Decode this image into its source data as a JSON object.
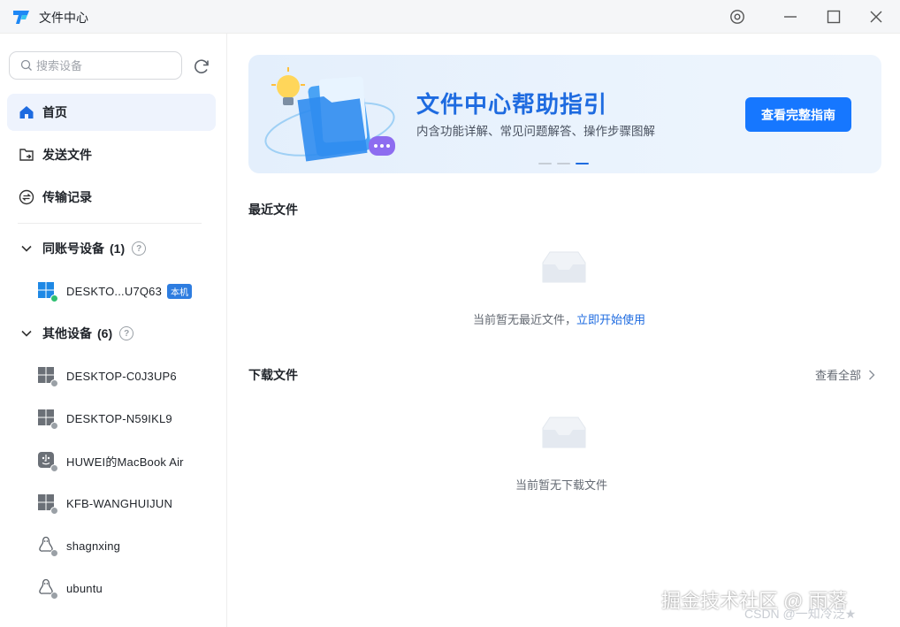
{
  "window": {
    "title": "文件中心",
    "buttons": [
      "settings-icon",
      "minimize-icon",
      "maximize-icon",
      "close-icon"
    ]
  },
  "sidebar": {
    "search_placeholder": "搜索设备",
    "nav": [
      {
        "label": "首页",
        "icon": "home-icon",
        "active": true
      },
      {
        "label": "发送文件",
        "icon": "send-file-icon",
        "active": false
      },
      {
        "label": "传输记录",
        "icon": "transfer-record-icon",
        "active": false
      }
    ],
    "groups": [
      {
        "label": "同账号设备",
        "count": "(1)",
        "expanded": true,
        "devices": [
          {
            "name": "DESKTO...U7Q63",
            "icon": "windows-icon",
            "badge": "本机",
            "online": true
          }
        ]
      },
      {
        "label": "其他设备",
        "count": "(6)",
        "expanded": true,
        "devices": [
          {
            "name": "DESKTOP-C0J3UP6",
            "icon": "windows-icon",
            "online": false
          },
          {
            "name": "DESKTOP-N59IKL9",
            "icon": "windows-icon",
            "online": false
          },
          {
            "name": "HUWEI的MacBook Air",
            "icon": "mac-icon",
            "online": false
          },
          {
            "name": "KFB-WANGHUIJUN",
            "icon": "windows-icon",
            "online": false
          },
          {
            "name": "shagnxing",
            "icon": "linux-icon",
            "online": false
          },
          {
            "name": "ubuntu",
            "icon": "linux-icon",
            "online": false
          }
        ]
      }
    ]
  },
  "banner": {
    "title": "文件中心帮助指引",
    "subtitle": "内含功能详解、常见问题解答、操作步骤图解",
    "button": "查看完整指南",
    "slides": 3,
    "active_slide": 3
  },
  "recent": {
    "title": "最近文件",
    "empty_text": "当前暂无最近文件，",
    "empty_link": "立即开始使用"
  },
  "downloads": {
    "title": "下载文件",
    "view_all": "查看全部",
    "empty_text": "当前暂无下载文件"
  },
  "watermark": {
    "main": "掘金技术社区 @ 雨落",
    "sub": "CSDN @一知冷泛★"
  },
  "colors": {
    "accent": "#1677ff",
    "title_blue": "#1e6be0",
    "online": "#2fbf71",
    "offline": "#9aa0a6",
    "active_nav_bg": "#eef3fd"
  }
}
